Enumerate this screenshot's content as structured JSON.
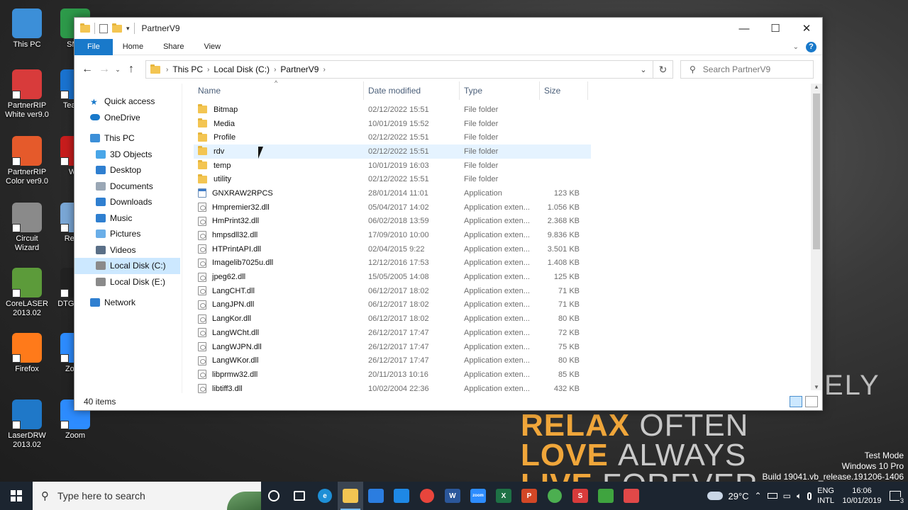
{
  "desktop": {
    "icons": [
      {
        "label": "This PC",
        "color": "#3c8fd8"
      },
      {
        "label": "SMA",
        "color": "#2d9a4a"
      },
      {
        "label": "PartnerRIP White ver9.0",
        "color": "#d83b3b"
      },
      {
        "label": "TeamV",
        "color": "#1a73d0"
      },
      {
        "label": "PartnerRIP Color ver9.0",
        "color": "#e55a2b"
      },
      {
        "label": "Wic",
        "color": "#c81d1d"
      },
      {
        "label": "Circuit Wizard",
        "color": "#8a8a8a"
      },
      {
        "label": "Recyc",
        "color": "#7aa7d6"
      },
      {
        "label": "CoreLASER 2013.02",
        "color": "#5c9b3a"
      },
      {
        "label": "DTG Shor",
        "color": "#222222"
      },
      {
        "label": "Firefox",
        "color": "#ff7a1a"
      },
      {
        "label": "Zoom",
        "color": "#2d8cff"
      },
      {
        "label": "LaserDRW 2013.02",
        "color": "#1f78c8"
      },
      {
        "label": "Zoom",
        "color": "#2d8cff"
      }
    ],
    "watermark": [
      "Test Mode",
      "Windows 10 Pro",
      "Build 19041.vb_release.191206-1406"
    ],
    "wallpaper": {
      "line1a": "RELAX",
      "line1b": "OFTEN",
      "line2a": "LOVE",
      "line2b": "ALWAYS",
      "line3a": "LIVE",
      "line3b": "FOREVER",
      "side": "ELY"
    }
  },
  "window": {
    "title": "PartnerV9",
    "controls": {
      "minimize": "—",
      "maximize": "☐",
      "close": "✕"
    },
    "ribbon": {
      "tabs": [
        "File",
        "Home",
        "Share",
        "View"
      ],
      "help": "?"
    },
    "address": {
      "crumbs": [
        "This PC",
        "Local Disk (C:)",
        "PartnerV9"
      ]
    },
    "search_placeholder": "Search PartnerV9",
    "sidebar": [
      {
        "label": "Quick access",
        "icon": "star-icon",
        "indent": 0,
        "color": "#1979ca"
      },
      {
        "label": "OneDrive",
        "icon": "cloud-icon",
        "indent": 0,
        "color": "#1979ca"
      },
      {
        "label": "This PC",
        "icon": "computer-icon",
        "indent": 0,
        "color": "#3c8fd8"
      },
      {
        "label": "3D Objects",
        "icon": "cube-icon",
        "indent": 1,
        "color": "#49a6e8"
      },
      {
        "label": "Desktop",
        "icon": "desktop-icon",
        "indent": 1,
        "color": "#2f7fd0"
      },
      {
        "label": "Documents",
        "icon": "document-icon",
        "indent": 1,
        "color": "#9aa7b5"
      },
      {
        "label": "Downloads",
        "icon": "download-icon",
        "indent": 1,
        "color": "#2f7fd0"
      },
      {
        "label": "Music",
        "icon": "music-icon",
        "indent": 1,
        "color": "#2f7fd0"
      },
      {
        "label": "Pictures",
        "icon": "picture-icon",
        "indent": 1,
        "color": "#6aaee8"
      },
      {
        "label": "Videos",
        "icon": "video-icon",
        "indent": 1,
        "color": "#5a6f87"
      },
      {
        "label": "Local Disk (C:)",
        "icon": "drive-icon",
        "indent": 1,
        "color": "#8a8a8a",
        "selected": true
      },
      {
        "label": "Local Disk (E:)",
        "icon": "drive-icon",
        "indent": 1,
        "color": "#8a8a8a"
      },
      {
        "label": "Network",
        "icon": "network-icon",
        "indent": 0,
        "color": "#2f7fd0"
      }
    ],
    "columns": {
      "name": "Name",
      "date": "Date modified",
      "type": "Type",
      "size": "Size"
    },
    "files": [
      {
        "name": "Bitmap",
        "date": "02/12/2022 15:51",
        "type": "File folder",
        "size": "",
        "kind": "folder"
      },
      {
        "name": "Media",
        "date": "10/01/2019 15:52",
        "type": "File folder",
        "size": "",
        "kind": "folder"
      },
      {
        "name": "Profile",
        "date": "02/12/2022 15:51",
        "type": "File folder",
        "size": "",
        "kind": "folder"
      },
      {
        "name": "rdv",
        "date": "02/12/2022 15:51",
        "type": "File folder",
        "size": "",
        "kind": "folder",
        "hover": true
      },
      {
        "name": "temp",
        "date": "10/01/2019 16:03",
        "type": "File folder",
        "size": "",
        "kind": "folder"
      },
      {
        "name": "utility",
        "date": "02/12/2022 15:51",
        "type": "File folder",
        "size": "",
        "kind": "folder"
      },
      {
        "name": "GNXRAW2RPCS",
        "date": "28/01/2014 11:01",
        "type": "Application",
        "size": "123 KB",
        "kind": "app"
      },
      {
        "name": "Hmpremier32.dll",
        "date": "05/04/2017 14:02",
        "type": "Application exten...",
        "size": "1.056 KB",
        "kind": "dll"
      },
      {
        "name": "HmPrint32.dll",
        "date": "06/02/2018 13:59",
        "type": "Application exten...",
        "size": "2.368 KB",
        "kind": "dll"
      },
      {
        "name": "hmpsdll32.dll",
        "date": "17/09/2010 10:00",
        "type": "Application exten...",
        "size": "9.836 KB",
        "kind": "dll"
      },
      {
        "name": "HTPrintAPI.dll",
        "date": "02/04/2015 9:22",
        "type": "Application exten...",
        "size": "3.501 KB",
        "kind": "dll"
      },
      {
        "name": "Imagelib7025u.dll",
        "date": "12/12/2016 17:53",
        "type": "Application exten...",
        "size": "1.408 KB",
        "kind": "dll"
      },
      {
        "name": "jpeg62.dll",
        "date": "15/05/2005 14:08",
        "type": "Application exten...",
        "size": "125 KB",
        "kind": "dll"
      },
      {
        "name": "LangCHT.dll",
        "date": "06/12/2017 18:02",
        "type": "Application exten...",
        "size": "71 KB",
        "kind": "dll"
      },
      {
        "name": "LangJPN.dll",
        "date": "06/12/2017 18:02",
        "type": "Application exten...",
        "size": "71 KB",
        "kind": "dll"
      },
      {
        "name": "LangKor.dll",
        "date": "06/12/2017 18:02",
        "type": "Application exten...",
        "size": "80 KB",
        "kind": "dll"
      },
      {
        "name": "LangWCht.dll",
        "date": "26/12/2017 17:47",
        "type": "Application exten...",
        "size": "72 KB",
        "kind": "dll"
      },
      {
        "name": "LangWJPN.dll",
        "date": "26/12/2017 17:47",
        "type": "Application exten...",
        "size": "75 KB",
        "kind": "dll"
      },
      {
        "name": "LangWKor.dll",
        "date": "26/12/2017 17:47",
        "type": "Application exten...",
        "size": "80 KB",
        "kind": "dll"
      },
      {
        "name": "libprmw32.dll",
        "date": "20/11/2013 10:16",
        "type": "Application exten...",
        "size": "85 KB",
        "kind": "dll"
      },
      {
        "name": "libtiff3.dll",
        "date": "10/02/2004 22:36",
        "type": "Application exten...",
        "size": "432 KB",
        "kind": "dll"
      }
    ],
    "status": "40 items"
  },
  "taskbar": {
    "search_placeholder": "Type here to search",
    "apps": [
      {
        "name": "cortana-icon",
        "label": "",
        "color": "transparent"
      },
      {
        "name": "task-view-icon",
        "label": "",
        "color": "transparent"
      },
      {
        "name": "edge-icon",
        "label": "e",
        "color": "#1e8fd6"
      },
      {
        "name": "file-explorer-icon",
        "label": "",
        "color": "#f3c552",
        "active": true
      },
      {
        "name": "store-icon",
        "label": "",
        "color": "#2b7de0"
      },
      {
        "name": "mail-icon",
        "label": "",
        "color": "#1e88e5"
      },
      {
        "name": "chrome-icon",
        "label": "",
        "color": "#e8453c"
      },
      {
        "name": "word-icon",
        "label": "W",
        "color": "#2b579a"
      },
      {
        "name": "zoom-icon",
        "label": "zoom",
        "color": "#2d8cff"
      },
      {
        "name": "excel-icon",
        "label": "X",
        "color": "#1e7145"
      },
      {
        "name": "powerpoint-icon",
        "label": "P",
        "color": "#d24726"
      },
      {
        "name": "chrome-icon-2",
        "label": "",
        "color": "#4caf50"
      },
      {
        "name": "partnerrip-icon",
        "label": "S",
        "color": "#d83b3b"
      },
      {
        "name": "corel-icon",
        "label": "",
        "color": "#3fa43f"
      },
      {
        "name": "corel-red-icon",
        "label": "",
        "color": "#e04848"
      }
    ],
    "weather": "29°C",
    "lang": [
      "ENG",
      "INTL"
    ],
    "time": "16:06",
    "date": "10/01/2019",
    "notif_count": "3"
  }
}
